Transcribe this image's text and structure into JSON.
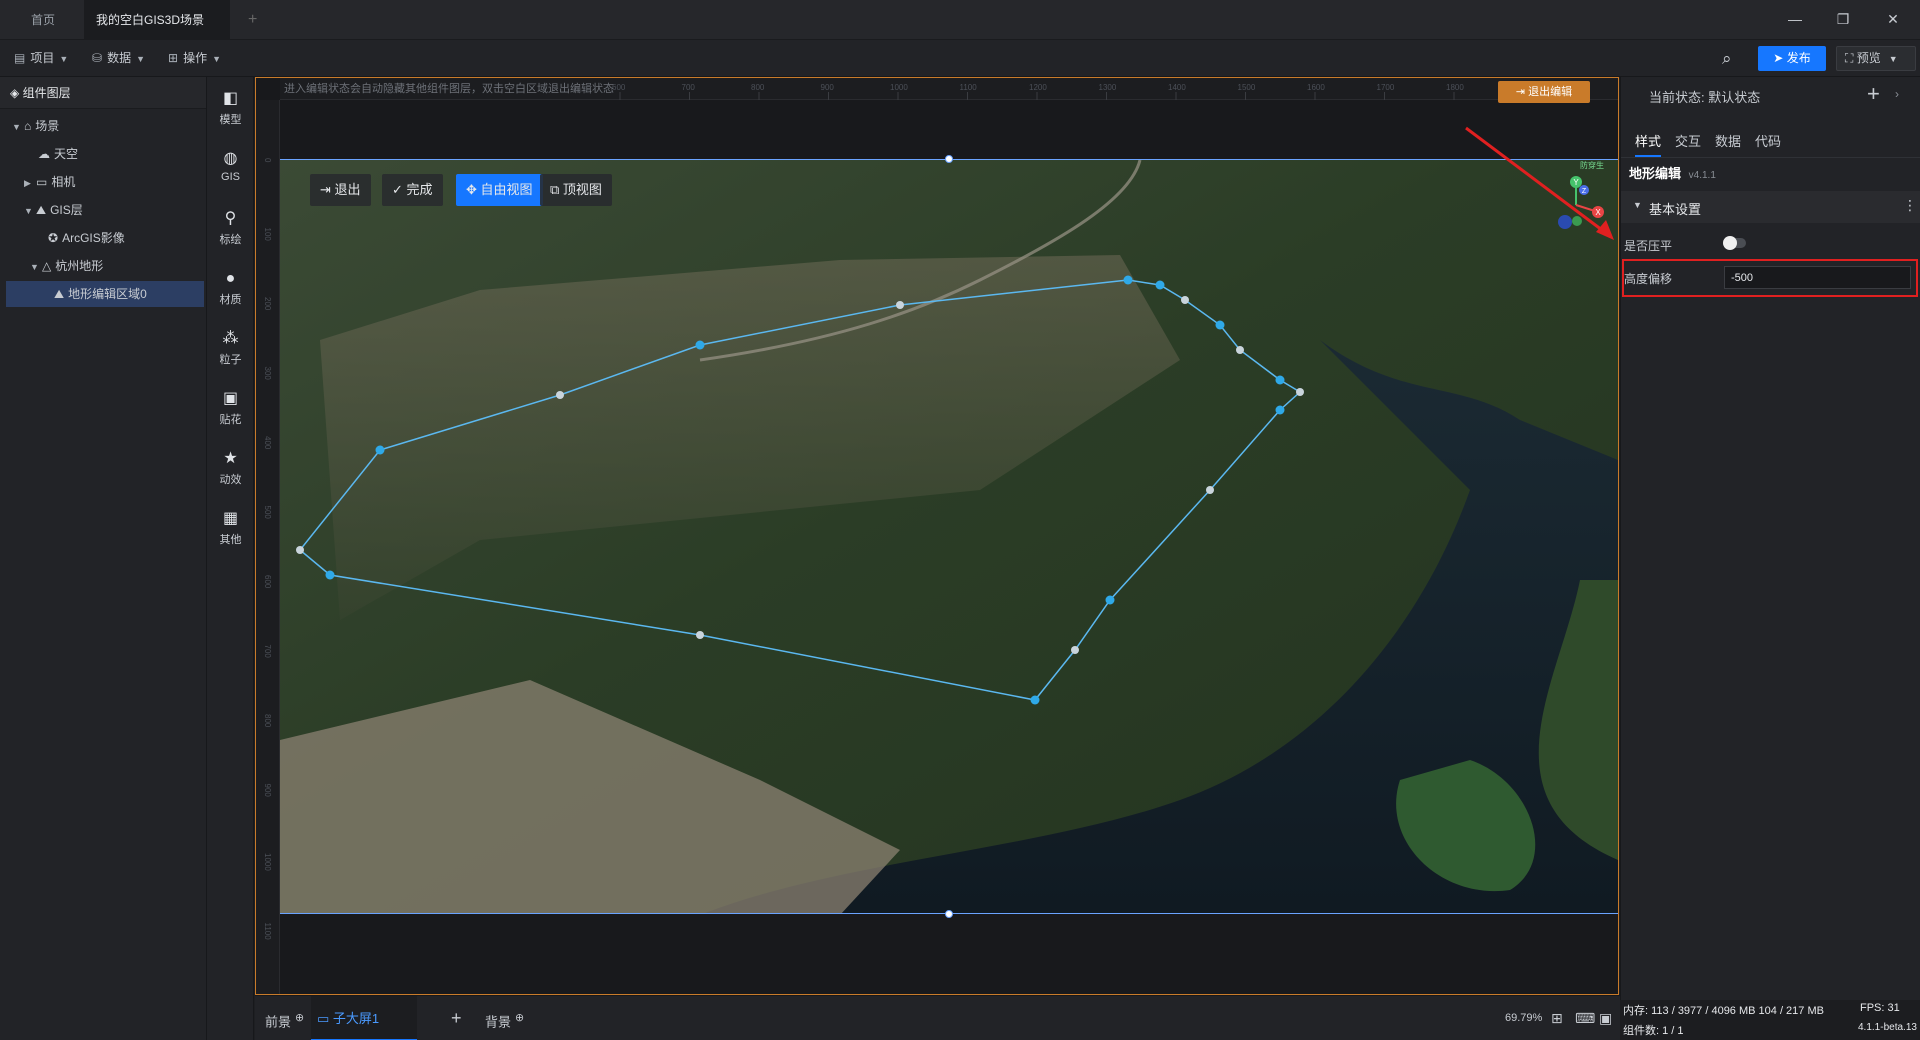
{
  "tabs": {
    "home": "首页",
    "scene": "我的空白GIS3D场景",
    "add": "+"
  },
  "window": {
    "minimize": "—",
    "restore": "❐",
    "close": "✕"
  },
  "menubar": {
    "project": "项目",
    "data": "数据",
    "operate": "操作",
    "publish": "发布",
    "preview": "预览"
  },
  "layers": {
    "title": "组件图层",
    "nodes": {
      "scene": "场景",
      "sky": "天空",
      "camera": "相机",
      "gis": "GIS层",
      "arcgis": "ArcGIS影像",
      "terrain": "杭州地形",
      "edit_area": "地形编辑区域0"
    }
  },
  "tools": {
    "model": "模型",
    "gis": "GIS",
    "mark": "标绘",
    "material": "材质",
    "particle": "粒子",
    "decal": "贴花",
    "effect": "动效",
    "other": "其他"
  },
  "canvas": {
    "hint": "进入编辑状态会自动隐藏其他组件图层，双击空白区域退出编辑状态",
    "exit_edit": "退出编辑",
    "hruler_ticks": [
      "600",
      "700",
      "800",
      "900",
      "1000",
      "1100",
      "1200",
      "1300",
      "1400",
      "1500",
      "1600",
      "1700",
      "1800",
      "1900"
    ],
    "vruler_ticks": [
      "0",
      "100",
      "200",
      "300",
      "400",
      "500",
      "600",
      "700",
      "800",
      "900",
      "1000",
      "1100",
      "1200"
    ],
    "view_buttons": {
      "exit": "退出",
      "done": "完成",
      "free_view": "自由视图",
      "top_view": "顶视图"
    },
    "axis": {
      "x": "X",
      "y": "Y",
      "z": "Z"
    },
    "corner_label": "防穿生"
  },
  "props": {
    "state_label": "当前状态:",
    "state_value": "默认状态",
    "tabs": {
      "style": "样式",
      "interact": "交互",
      "data": "数据",
      "code": "代码"
    },
    "component_title": "地形编辑",
    "version": "v4.1.1",
    "section": "基本设置",
    "flatten_label": "是否压平",
    "flatten_on": false,
    "offset_label": "高度偏移",
    "offset_value": "-500"
  },
  "bottom": {
    "front": "前景",
    "sub_screen": "子大屏1",
    "add": "+",
    "back": "背景",
    "zoom": "69.79%"
  },
  "status": {
    "memory": "内存:  113 / 3977 / 4096 MB  104 / 217 MB",
    "fps": "FPS:  31",
    "components": "组件数: 1 / 1",
    "build": "4.1.1-beta.13"
  },
  "colors": {
    "accent": "#1677ff",
    "edit_border": "#c97b2a",
    "highlight": "#e02020"
  }
}
